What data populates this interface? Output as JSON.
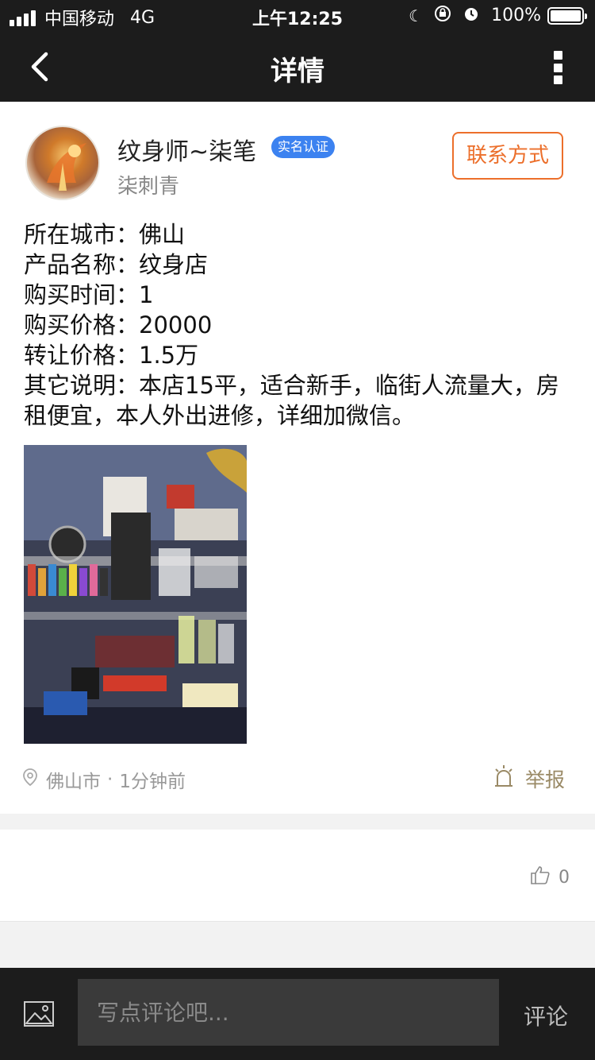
{
  "status_bar": {
    "carrier": "中国移动",
    "network": "4G",
    "time": "上午12:25",
    "battery": "100%",
    "battery_level": 1.0
  },
  "nav": {
    "title": "详情",
    "back_icon": "chevron-left-icon",
    "more_icon": "more-vertical-icon"
  },
  "post": {
    "user_name": "纹身师~柒笔",
    "verified_badge": "实名认证",
    "user_subtitle": "柒刺青",
    "contact_button": "联系方式",
    "details": [
      {
        "label": "所在城市：",
        "value": "佛山"
      },
      {
        "label": "产品名称：",
        "value": "纹身店"
      },
      {
        "label": "购买时间：",
        "value": "1"
      },
      {
        "label": "购买价格：",
        "value": "20000"
      },
      {
        "label": "转让价格：",
        "value": "1.5万"
      },
      {
        "label": "其它说明：",
        "value": "本店15平，适合新手，临街人流量大，房租便宜，本人外出进修，详细加微信。"
      }
    ],
    "location": "佛山市",
    "separator": "·",
    "time_ago": "1分钟前",
    "report_label": "举报"
  },
  "likes": {
    "count": "0"
  },
  "comment_bar": {
    "placeholder": "写点评论吧...",
    "submit_label": "评论"
  },
  "colors": {
    "accent": "#ec6f2b",
    "badge": "#3c82f0",
    "dark_bar": "#1c1c1c"
  }
}
